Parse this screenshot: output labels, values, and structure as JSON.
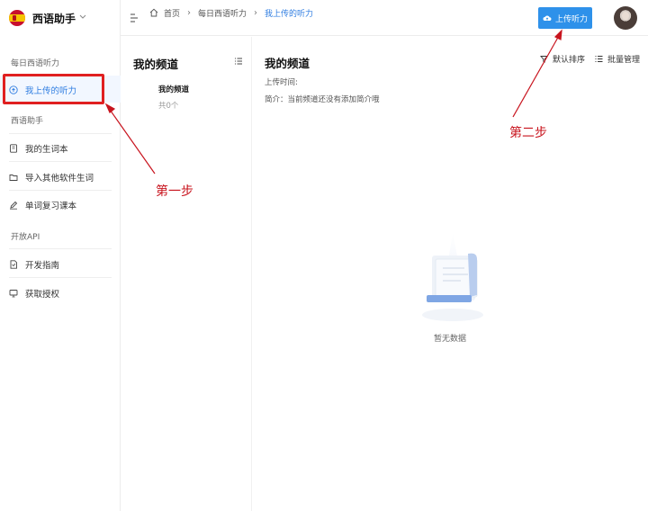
{
  "app": {
    "name": "西语助手"
  },
  "sidebar": {
    "groups": [
      {
        "label": "每日西语听力"
      },
      {
        "label": "西语助手"
      },
      {
        "label": "开放API"
      }
    ],
    "items": [
      {
        "label": "我上传的听力",
        "icon": "upload-cloud-icon",
        "active": true
      },
      {
        "label": "我的生词本",
        "icon": "notebook-icon"
      },
      {
        "label": "导入其他软件生词",
        "icon": "folder-icon"
      },
      {
        "label": "单词复习课本",
        "icon": "pencil-icon"
      },
      {
        "label": "开发指南",
        "icon": "document-icon"
      },
      {
        "label": "获取授权",
        "icon": "monitor-icon"
      }
    ]
  },
  "header": {
    "breadcrumb": [
      "首页",
      "每日西语听力",
      "我上传的听力"
    ],
    "upload_label": "上传听力"
  },
  "channels": {
    "title": "我的频道",
    "items": [
      {
        "name": "我的频道",
        "count": "共0个"
      }
    ]
  },
  "main": {
    "title": "我的频道",
    "upload_time_label": "上传时间:",
    "intro_label": "简介：当前频道还没有添加简介哦",
    "sort_label": "默认排序",
    "batch_label": "批量管理",
    "empty_text": "暂无数据"
  },
  "annotations": {
    "step1": "第一步",
    "step2": "第二步",
    "color": "#c8141e"
  }
}
